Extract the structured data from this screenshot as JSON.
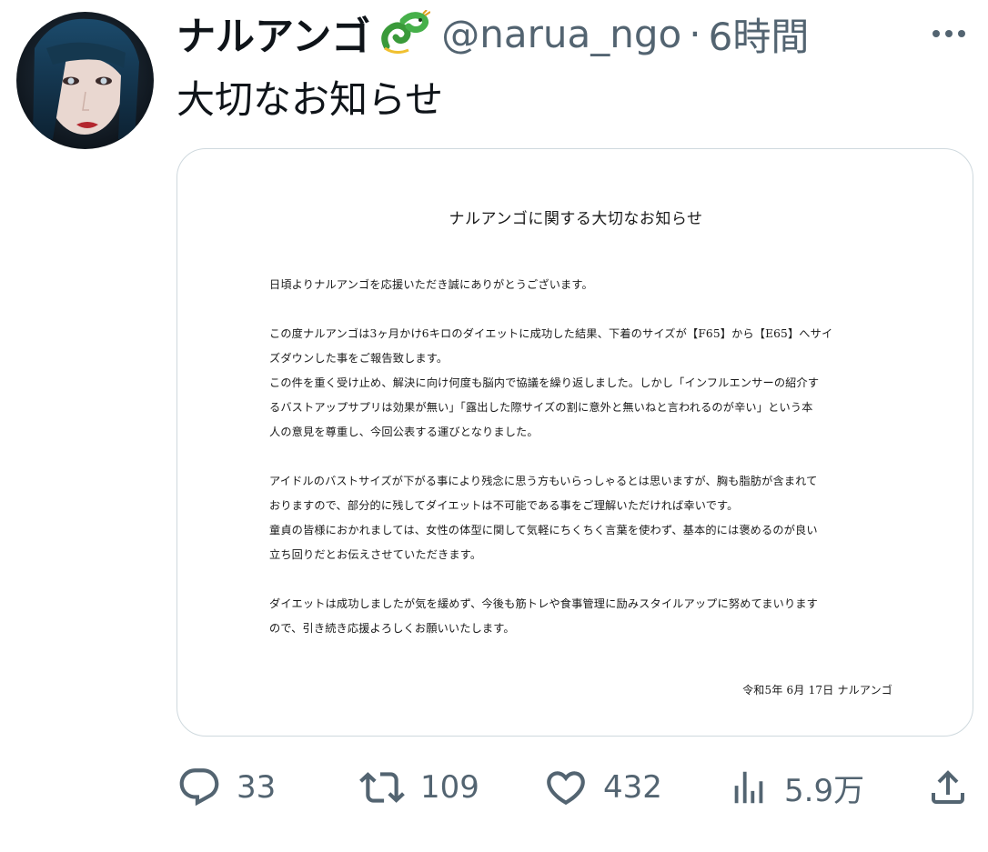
{
  "author": {
    "display_name": "ナルアンゴ",
    "handle": "@narua_ngo",
    "separator": "·",
    "time": "6時間"
  },
  "icons": {
    "avatar": "avatar",
    "name_emoji": "dragon-icon",
    "more": "more-icon",
    "reply": "reply-icon",
    "retweet": "retweet-icon",
    "like": "heart-icon",
    "views": "views-icon",
    "share": "share-icon"
  },
  "tweet_text": "大切なお知らせ",
  "attachment": {
    "title": "ナルアンゴに関する大切なお知らせ",
    "lines": [
      "日頃よりナルアンゴを応援いただき誠にありがとうございます。",
      "",
      "この度ナルアンゴは3ヶ月かけ6キロのダイエットに成功した結果、下着のサイズが【F65】から【E65】へサイ",
      "ズダウンした事をご報告致します。",
      "この件を重く受け止め、解決に向け何度も脳内で協議を繰り返しました。しかし「インフルエンサーの紹介す",
      "るバストアップサプリは効果が無い」「露出した際サイズの割に意外と無いねと言われるのが辛い」という本",
      "人の意見を尊重し、今回公表する運びとなりました。",
      "",
      "アイドルのバストサイズが下がる事により残念に思う方もいらっしゃるとは思いますが、胸も脂肪が含まれて",
      "おりますので、部分的に残してダイエットは不可能である事をご理解いただければ幸いです。",
      "童貞の皆様におかれましては、女性の体型に関して気軽にちくちく言葉を使わず、基本的には褒めるのが良い",
      "立ち回りだとお伝えさせていただきます。",
      "",
      "ダイエットは成功しましたが気を緩めず、今後も筋トレや食事管理に励みスタイルアップに努めてまいります",
      "ので、引き続き応援よろしくお願いいたします。"
    ],
    "date": "令和5年 6月 17日 ナルアンゴ"
  },
  "stats": {
    "replies": "33",
    "retweets": "109",
    "likes": "432",
    "views": "5.9万"
  },
  "colors": {
    "text": "#0f1419",
    "secondary": "#536471",
    "border": "#cfd9de"
  }
}
